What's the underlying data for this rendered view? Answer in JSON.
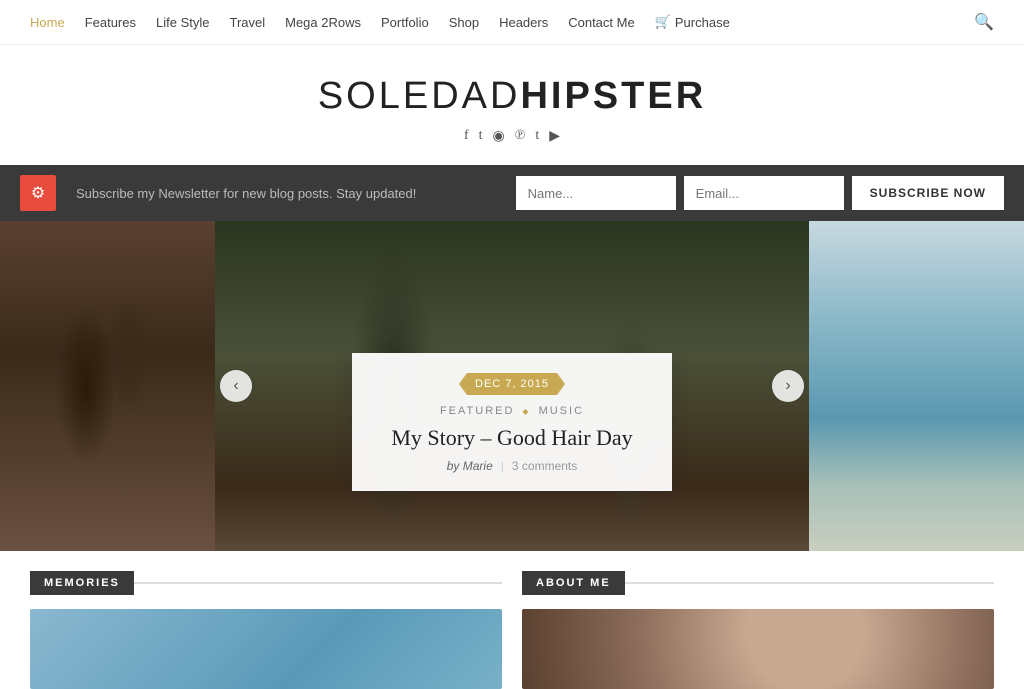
{
  "nav": {
    "links": [
      {
        "label": "Home",
        "active": true
      },
      {
        "label": "Features",
        "active": false
      },
      {
        "label": "Life Style",
        "active": false
      },
      {
        "label": "Travel",
        "active": false
      },
      {
        "label": "Mega 2Rows",
        "active": false
      },
      {
        "label": "Portfolio",
        "active": false
      },
      {
        "label": "Shop",
        "active": false
      },
      {
        "label": "Headers",
        "active": false
      },
      {
        "label": "Contact Me",
        "active": false
      }
    ],
    "purchase_label": "Purchase"
  },
  "site": {
    "title_part1": "SOLEDAD",
    "title_part2": "HIPSTER"
  },
  "social": {
    "icons": [
      "f",
      "t",
      "◉",
      "℗",
      "t",
      "▶"
    ]
  },
  "subscribe": {
    "text": "Subscribe my Newsletter for new blog posts. Stay updated!",
    "name_placeholder": "Name...",
    "email_placeholder": "Email...",
    "button_label": "SUBSCRIBE NOW"
  },
  "slider": {
    "date": "DEC 7, 2015",
    "category1": "FEATURED",
    "diamond": "◆",
    "category2": "MUSIC",
    "title": "My Story – Good Hair Day",
    "author_prefix": "by",
    "author": "Marie",
    "separator": "|",
    "comments": "3 comments"
  },
  "sections": {
    "memories": {
      "label": "MEMORIES"
    },
    "about": {
      "label": "ABOUT ME"
    }
  },
  "arrows": {
    "left": "‹",
    "right": "›"
  }
}
